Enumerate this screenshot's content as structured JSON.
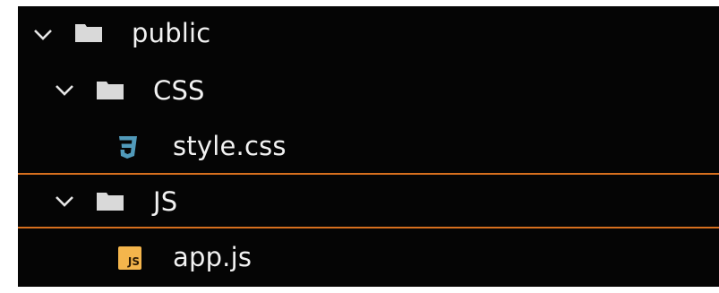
{
  "tree": {
    "items": [
      {
        "label": "public",
        "kind": "folder",
        "expanded": true,
        "icon": "folder-icon",
        "chevron": "chevron-down-icon"
      },
      {
        "label": "CSS",
        "kind": "folder",
        "expanded": true,
        "icon": "folder-icon",
        "chevron": "chevron-down-icon"
      },
      {
        "label": "style.css",
        "kind": "file",
        "icon": "css3-file-icon"
      },
      {
        "label": "JS",
        "kind": "folder",
        "expanded": true,
        "focused": true,
        "icon": "folder-icon",
        "chevron": "chevron-down-icon"
      },
      {
        "label": "app.js",
        "kind": "file",
        "icon": "js-file-icon",
        "badge": "JS"
      }
    ]
  },
  "colors": {
    "background": "#050505",
    "text": "#f2f2f2",
    "folder": "#d9d9d9",
    "focus_border": "#d66f1e",
    "css_icon": "#519aba",
    "js_icon": "#f4b54c"
  }
}
